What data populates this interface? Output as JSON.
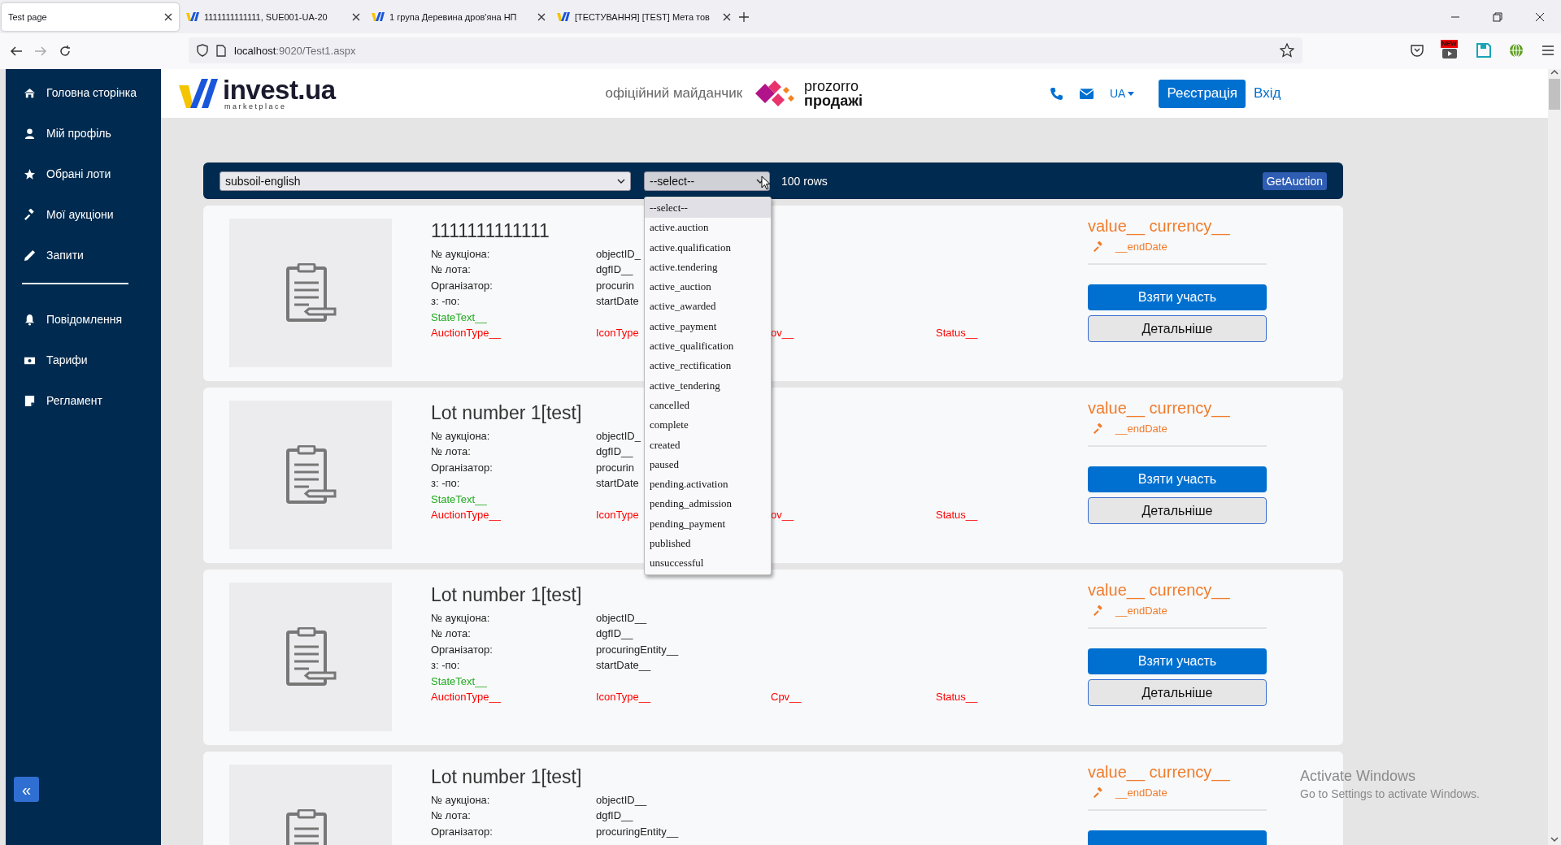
{
  "browser": {
    "tabs": [
      {
        "title": "Test page",
        "selected": true
      },
      {
        "title": "1111111111111, SUE001-UA-20",
        "selected": false
      },
      {
        "title": "1 група Деревина дров'яна НП",
        "selected": false
      },
      {
        "title": "[ТЕСТУВАННЯ] [TEST] Мета тов",
        "selected": false
      }
    ],
    "url_host": "localhost",
    "url_rest": ":9020/Test1.aspx",
    "extension_badge": "NEW"
  },
  "sidebar": {
    "groups": [
      [
        {
          "label": "Головна сторінка"
        },
        {
          "label": "Мій профіль"
        },
        {
          "label": "Обрані лоти"
        },
        {
          "label": "Мої аукціони"
        },
        {
          "label": "Запити"
        }
      ],
      [
        {
          "label": "Повідомлення"
        },
        {
          "label": "Тарифи"
        },
        {
          "label": "Регламент"
        }
      ]
    ],
    "collapse_button": "«"
  },
  "header": {
    "brand": "invest.ua",
    "brand_sub": "marketplace",
    "tagline": "офіційний майданчик",
    "partner_top": "prozorro",
    "partner_bottom": "продажі",
    "language": "UA",
    "register": "Реєстрація",
    "login": "Вхід"
  },
  "filter": {
    "type_select": "subsoil-english",
    "status_select": {
      "value": "--select--",
      "expanded": true,
      "options": [
        {
          "label": "--select--",
          "selected": true
        },
        {
          "label": "active.auction",
          "selected": false
        },
        {
          "label": "active.qualification",
          "selected": false
        },
        {
          "label": "active.tendering",
          "selected": false
        },
        {
          "label": "active_auction",
          "selected": false
        },
        {
          "label": "active_awarded",
          "selected": false
        },
        {
          "label": "active_payment",
          "selected": false
        },
        {
          "label": "active_qualification",
          "selected": false
        },
        {
          "label": "active_rectification",
          "selected": false
        },
        {
          "label": "active_tendering",
          "selected": false
        },
        {
          "label": "cancelled",
          "selected": false
        },
        {
          "label": "complete",
          "selected": false
        },
        {
          "label": "created",
          "selected": false
        },
        {
          "label": "paused",
          "selected": false
        },
        {
          "label": "pending.activation",
          "selected": false
        },
        {
          "label": "pending_admission",
          "selected": false
        },
        {
          "label": "pending_payment",
          "selected": false
        },
        {
          "label": "published",
          "selected": false
        },
        {
          "label": "unsuccessful",
          "selected": false
        }
      ]
    },
    "rows": "100 rows",
    "button": "GetAuction"
  },
  "cards": [
    {
      "title": "1111111111111",
      "fields": [
        {
          "label": "№ аукціона:",
          "value": "objectID_"
        },
        {
          "label": "№ лота:",
          "value": "dgfID__"
        },
        {
          "label": "Організатор:",
          "value": "procurin"
        },
        {
          "label": "з: -по:",
          "value": "startDate"
        }
      ],
      "state": "StateText__",
      "types": [
        "AuctionType__",
        "IconType",
        "ov__",
        "Status__"
      ],
      "price": "value__ currency__",
      "end_date": "__endDate",
      "buttons": [
        "Взяти участь",
        "Детальніше"
      ]
    },
    {
      "title": "Lot number 1[test]",
      "fields": [
        {
          "label": "№ аукціона:",
          "value": "objectID_"
        },
        {
          "label": "№ лота:",
          "value": "dgfID__"
        },
        {
          "label": "Організатор:",
          "value": "procurin"
        },
        {
          "label": "з: -по:",
          "value": "startDate"
        }
      ],
      "state": "StateText__",
      "types": [
        "AuctionType__",
        "IconType",
        "ov__",
        "Status__"
      ],
      "price": "value__ currency__",
      "end_date": "__endDate",
      "buttons": [
        "Взяти участь",
        "Детальніше"
      ]
    },
    {
      "title": "Lot number 1[test]",
      "fields": [
        {
          "label": "№ аукціона:",
          "value": "objectID__"
        },
        {
          "label": "№ лота:",
          "value": "dgfID__"
        },
        {
          "label": "Організатор:",
          "value": "procuringEntity__"
        },
        {
          "label": "з: -по:",
          "value": "startDate__"
        }
      ],
      "state": "StateText__",
      "types": [
        "AuctionType__",
        "IconType__",
        "Cpv__",
        "Status__"
      ],
      "price": "value__ currency__",
      "end_date": "__endDate",
      "buttons": [
        "Взяти участь",
        "Детальніше"
      ]
    },
    {
      "title": "Lot number 1[test]",
      "fields": [
        {
          "label": "№ аукціона:",
          "value": "objectID__"
        },
        {
          "label": "№ лота:",
          "value": "dgfID__"
        },
        {
          "label": "Організатор:",
          "value": "procuringEntity__"
        }
      ],
      "price": "value__ currency__",
      "end_date": "__endDate",
      "cut_button": true
    }
  ],
  "os_notice": {
    "title": "Activate Windows",
    "text": "Go to Settings to activate Windows."
  }
}
